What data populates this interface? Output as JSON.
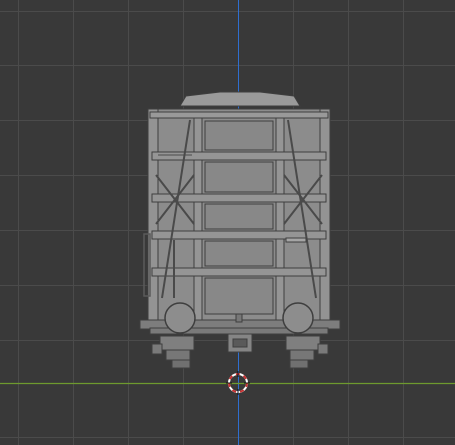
{
  "viewport": {
    "view": "front-orthographic",
    "background_color": "#393939",
    "grid_color": "#4b4b4b",
    "grid_major_color": "#545454",
    "axis_z_color": "#2f6fd0",
    "axis_y_color": "#6e9a2e",
    "model_fill": "#8c8c8c",
    "model_stroke": "#3e3e3e",
    "cursor": {
      "icon": "3d-cursor-icon",
      "color": "#c83232"
    },
    "model_label": "",
    "overlay_text": ""
  }
}
